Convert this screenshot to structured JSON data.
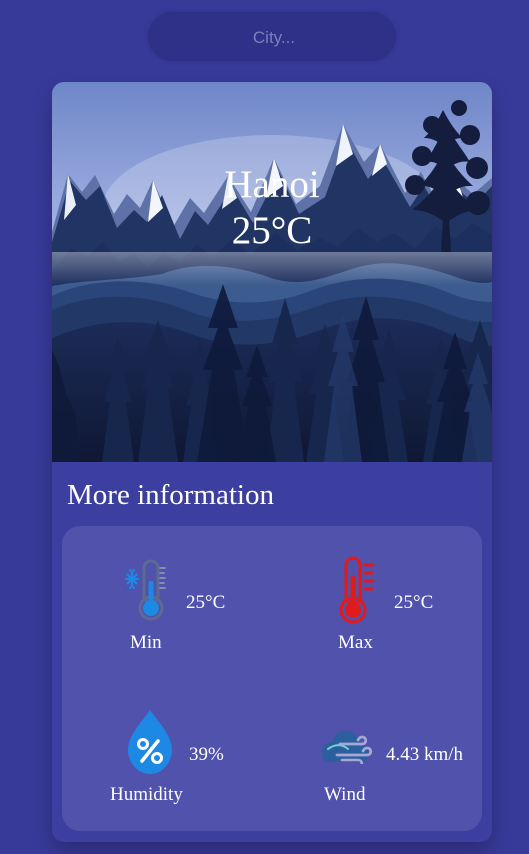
{
  "search": {
    "placeholder": "City...",
    "value": ""
  },
  "weather": {
    "city": "Hanoi",
    "temperature": "25°C"
  },
  "details": {
    "title": "More information",
    "min": {
      "label": "Min",
      "value": "25°C",
      "icon": "thermometer-snowflake-icon"
    },
    "max": {
      "label": "Max",
      "value": "25°C",
      "icon": "thermometer-hot-icon"
    },
    "humidity": {
      "label": "Humidity",
      "value": "39%",
      "icon": "humidity-drop-icon"
    },
    "wind": {
      "label": "Wind",
      "value": "4.43 km/h",
      "icon": "wind-icon"
    }
  },
  "colors": {
    "page_background": "#383a9a",
    "card_background": "#3d3fa0",
    "panel_background": "#5052ab",
    "search_background": "#2f3188",
    "text": "#ffffff",
    "min_icon_blue": "#1e88e5",
    "max_icon_red": "#e11b1b",
    "humidity_blue": "#1e88e5"
  }
}
